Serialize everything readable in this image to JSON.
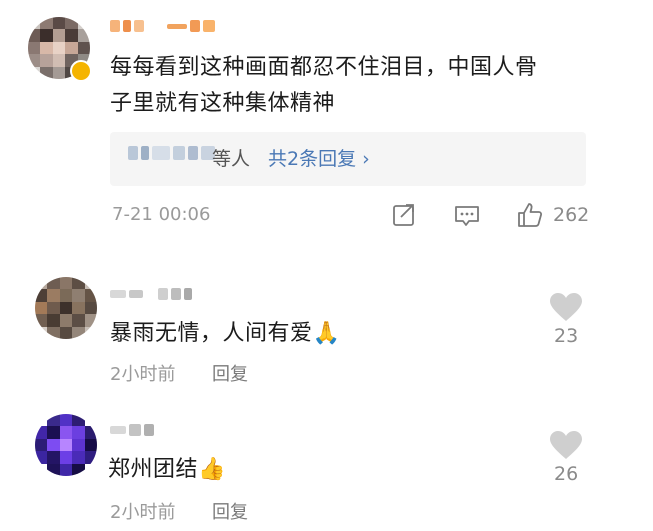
{
  "comment_main": {
    "text": "每每看到这种画面都忍不住泪目，中国人骨子里就有这种集体精神",
    "line1": "每每看到这种画面都忍不住泪目，中国人骨",
    "line2": "子里就有这种集体精神",
    "reply_summary_suffix": "等人",
    "reply_link": "共2条回复 ›",
    "time": "7-21 00:06",
    "like_count": "262"
  },
  "reply1": {
    "text": "暴雨无情，人间有爱🙏",
    "time": "2小时前",
    "reply_label": "回复",
    "like_count": "23"
  },
  "reply2": {
    "text": "郑州团结👍",
    "time": "2小时前",
    "reply_label": "回复",
    "like_count": "26"
  },
  "icons": {
    "share": "share-icon",
    "comment": "comment-icon",
    "like": "thumbs-up-icon",
    "heart": "heart-icon"
  },
  "colors": {
    "link": "#4a78b5",
    "meta": "#9a9a9a",
    "reply_bg": "#f5f5f5",
    "heart": "#cfcfcf"
  }
}
